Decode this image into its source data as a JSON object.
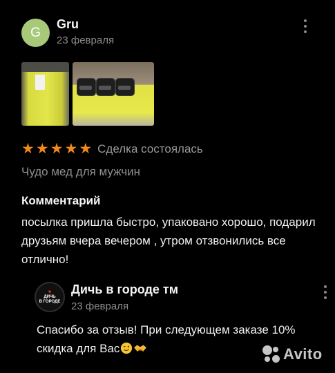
{
  "review": {
    "author": {
      "initial": "G",
      "name": "Gru",
      "date": "23 февраля",
      "avatar_color": "#a8c97a"
    },
    "rating": {
      "stars": 5,
      "max": 5,
      "status": "Сделка состоялась",
      "star_color": "#f28a1b"
    },
    "product": "Чудо мед для мужчин",
    "comment_title": "Комментарий",
    "comment": "посылка пришла быстро, упаковано хорошо, подарил друзьям вчера вечером , утром отзвонились все отлично!"
  },
  "reply": {
    "logo_text": [
      "ДИЧЬ",
      "В ГОРОДЕ"
    ],
    "name": "Дичь в городе тм",
    "date": "23 февраля",
    "text": "Спасибо за отзыв! При следующем заказе 10% скидка для Вас",
    "emojis": [
      "winking-face",
      "handshake"
    ]
  },
  "watermark": "Avito"
}
